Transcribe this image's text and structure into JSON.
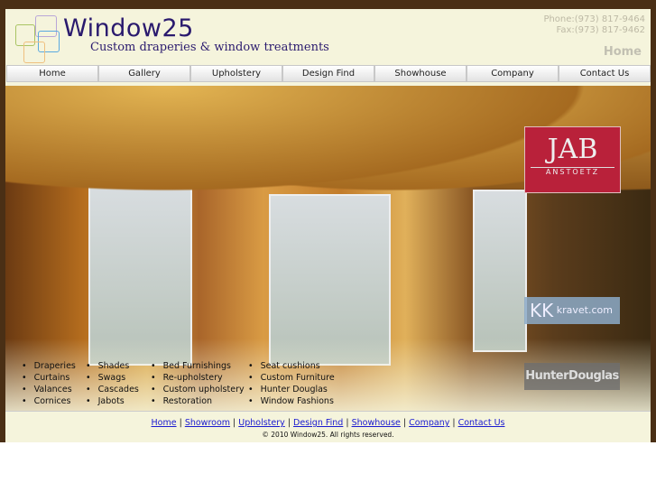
{
  "header": {
    "brand": "Window25",
    "tagline": "Custom draperies & window treatments",
    "phone": "Phone:(973) 817-9464",
    "fax": "Fax:(973) 817-9462",
    "page_title": "Home"
  },
  "nav": [
    "Home",
    "Gallery",
    "Upholstery",
    "Design Find",
    "Showhouse",
    "Company",
    "Contact Us"
  ],
  "brands": {
    "jab": "JAB",
    "jab_sub": "ANSTOETZ",
    "kravet_mark": "KK",
    "kravet": "kravet.com",
    "hunter": "HunterDouglas"
  },
  "services": [
    [
      "Draperies",
      "Curtains",
      "Valances",
      "Cornices"
    ],
    [
      "Shades",
      "Swags",
      "Cascades",
      "Jabots"
    ],
    [
      "Bed Furnishings",
      "Re-upholstery",
      "Custom upholstery",
      "Restoration"
    ],
    [
      "Seat cushions",
      "Custom Furniture",
      "Hunter Douglas",
      "Window Fashions"
    ]
  ],
  "footer": {
    "links": [
      "Home",
      "Showroom",
      "Upholstery",
      "Design Find",
      "Showhouse",
      "Company",
      "Contact Us"
    ],
    "copyright": "© 2010 Window25. All rights reserved."
  },
  "colors": {
    "frame_bg": "#f5f4dc",
    "outer_bg": "#4a2f15",
    "brand": "#2a1a6e",
    "link": "#1a1ad0"
  }
}
